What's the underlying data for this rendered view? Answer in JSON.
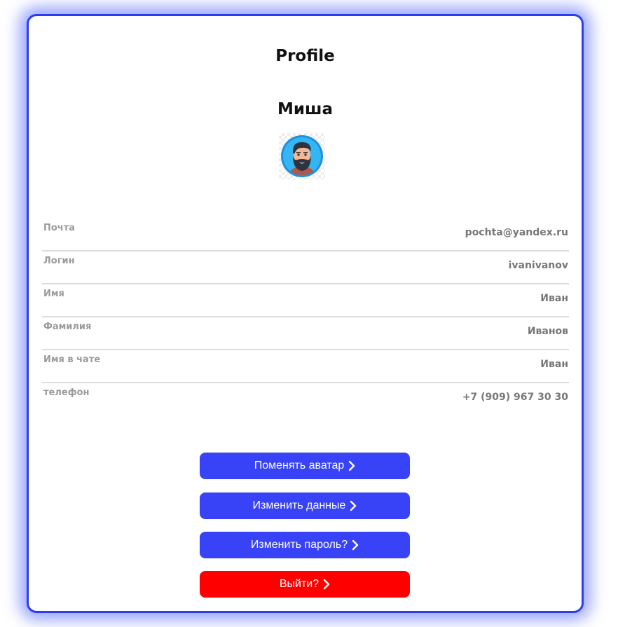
{
  "page": {
    "title": "Profile",
    "user_name": "Миша"
  },
  "avatar": {
    "icon": "bearded-man-avatar"
  },
  "fields": [
    {
      "label": "Почта",
      "value": "pochta@yandex.ru"
    },
    {
      "label": "Логин",
      "value": "ivanivanov"
    },
    {
      "label": "Имя",
      "value": "Иван"
    },
    {
      "label": "Фамилия",
      "value": "Иванов"
    },
    {
      "label": "Имя в чате",
      "value": "Иван"
    },
    {
      "label": "телефон",
      "value": "+7 (909) 967 30 30"
    }
  ],
  "actions": {
    "change_avatar": "Поменять аватар",
    "change_data": "Изменить данные",
    "change_password": "Изменить пароль?",
    "logout": "Выйти?"
  },
  "colors": {
    "accent": "#3843f7",
    "danger": "#ff0000",
    "card_border": "#2a3cf5"
  }
}
